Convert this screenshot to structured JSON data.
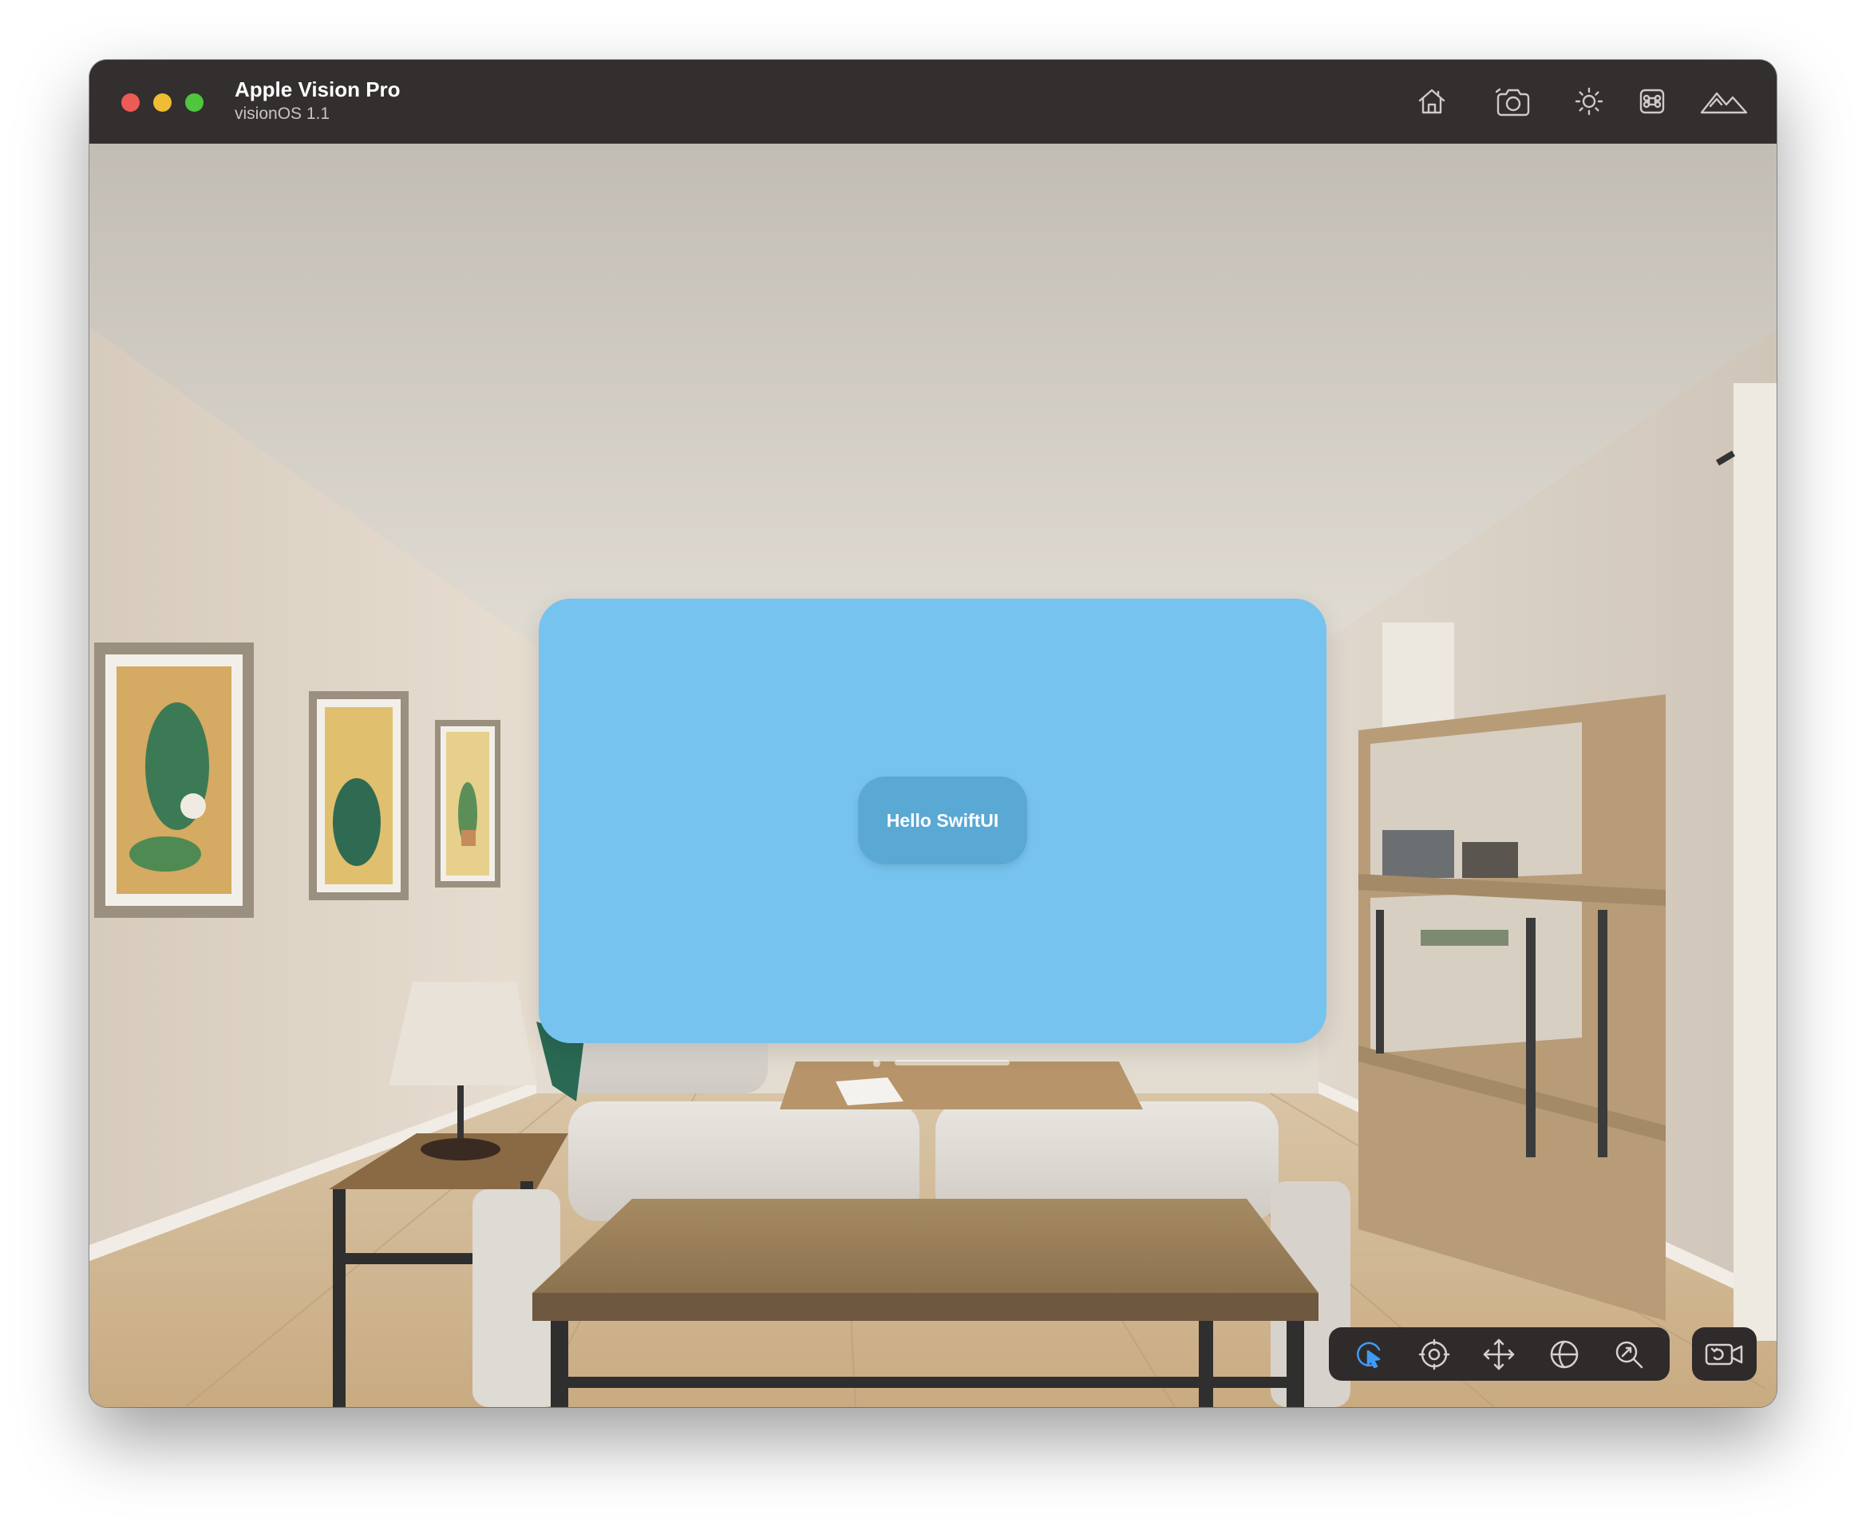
{
  "window": {
    "title": "Apple Vision Pro",
    "subtitle": "visionOS 1.1"
  },
  "toolbar": {
    "icons": [
      "home-icon",
      "camera-icon",
      "brightness-icon",
      "command-icon",
      "environment-icon"
    ]
  },
  "app": {
    "button_label": "Hello SwiftUI",
    "panel_color": "#77c3ef",
    "button_color": "#5aa8d4"
  },
  "controls": {
    "icons": [
      "pointer-icon",
      "look-icon",
      "pan-icon",
      "orbit-icon",
      "zoom-icon",
      "reset-camera-icon"
    ],
    "active": "pointer-icon",
    "active_color": "#3f9bf5"
  },
  "traffic_lights": {
    "close": "#ee5b56",
    "minimize": "#f0bc33",
    "maximize": "#4fc63e"
  }
}
